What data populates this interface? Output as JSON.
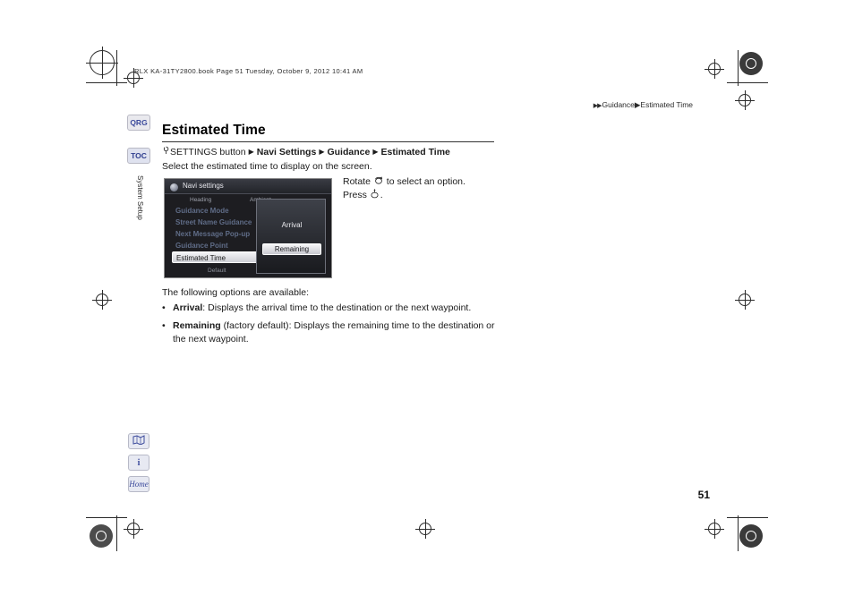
{
  "document": {
    "filestamp": "RLX KA-31TY2800.book  Page 51  Tuesday, October 9, 2012  10:41 AM",
    "breadcrumb_arrow": "▶▶",
    "breadcrumb": "Guidance▶Estimated Time",
    "page_number": "51"
  },
  "sidetabs": {
    "qrg": "QRG",
    "toc": "TOC",
    "section": "System Setup",
    "map_icon": "map-icon",
    "info_icon": "i",
    "home_icon": "Home"
  },
  "main": {
    "title": "Estimated Time",
    "nav_path": {
      "knob_icon": "↻",
      "settings": "SETTINGS button",
      "arrow": "▶",
      "navi_settings": "Navi Settings",
      "guidance": "Guidance",
      "estimated_time": "Estimated Time"
    },
    "lead": "Select the estimated time to display on the screen.",
    "rotate_text_before": "Rotate",
    "rotate_text_after": "to select an option.",
    "press_text": "Press",
    "press_text_after": ".",
    "following": "The following options are available:",
    "options": [
      {
        "name": "Arrival",
        "suffix": "",
        "description": ": Displays the arrival time to the destination or the next waypoint."
      },
      {
        "name": "Remaining",
        "suffix": " (factory default)",
        "description": ": Displays the remaining time to the destination or the next waypoint."
      }
    ]
  },
  "device_screen": {
    "title": "Navi settings",
    "column_headers": [
      "Heading",
      "Ambient"
    ],
    "menu_items": [
      "Guidance Mode",
      "Street Name Guidance",
      "Next Message Pop-up",
      "Guidance Point",
      "Estimated Time"
    ],
    "selected_menu_item": "Estimated Time",
    "default_label": "Default",
    "popup_options": [
      "Arrival",
      "Remaining"
    ],
    "popup_selected": "Remaining"
  }
}
